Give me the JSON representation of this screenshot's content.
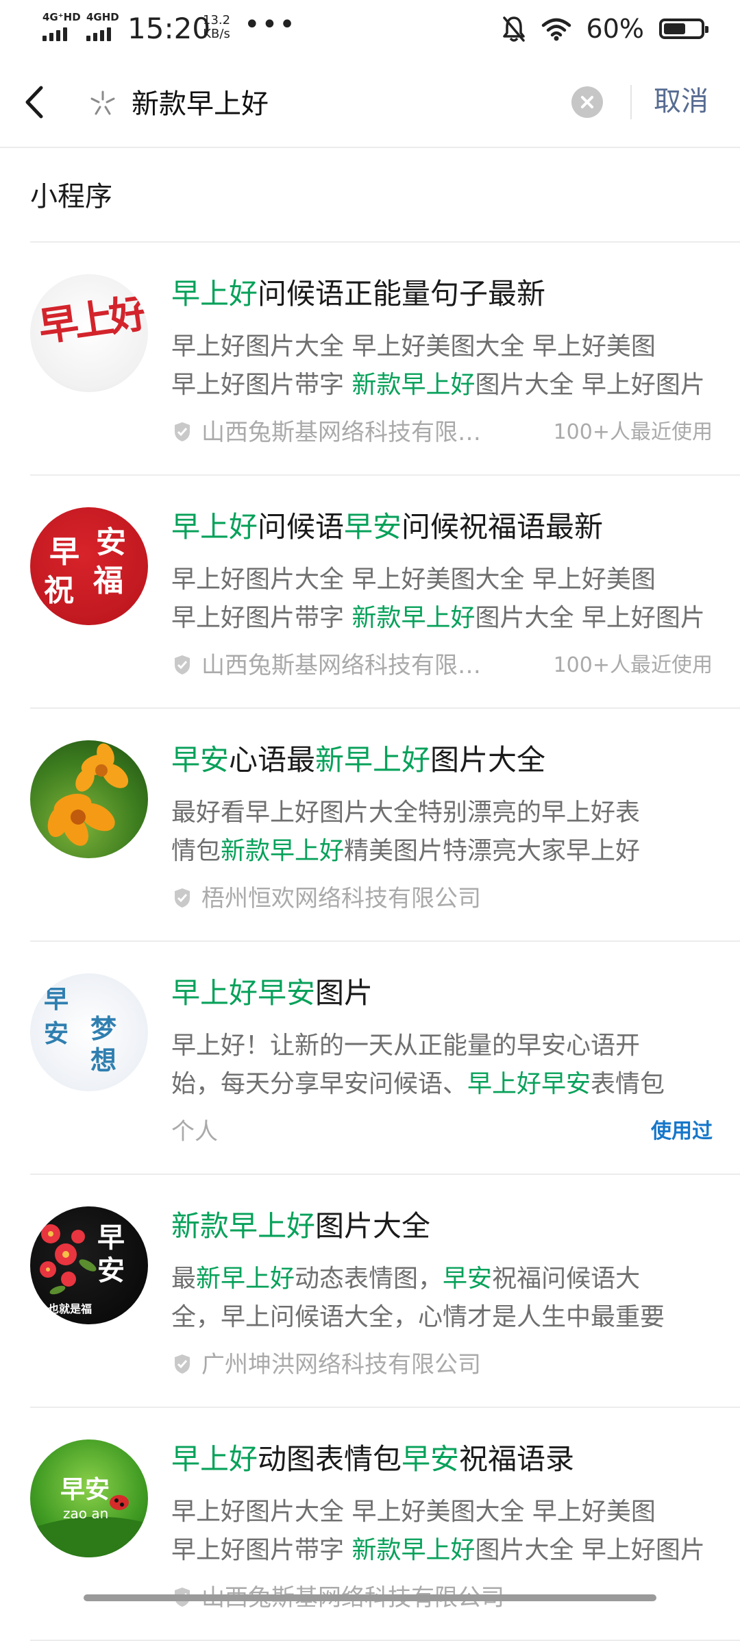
{
  "status_bar": {
    "net1": "4G⁺HD",
    "net2": "4GHD",
    "time": "15:20",
    "speed_value": "13.2",
    "speed_unit": "KB/s",
    "more": "•••",
    "battery_pct": "60%",
    "battery_level": 0.6
  },
  "search": {
    "query": "新款早上好",
    "cancel_label": "取消"
  },
  "section_title": "小程序",
  "colors": {
    "highlight": "#07a15a",
    "link_blue": "#1677c9",
    "cancel": "#566b91"
  },
  "results": [
    {
      "title": [
        {
          "t": "早上好",
          "h": true
        },
        {
          "t": "问候语正能量句子最新",
          "h": false
        }
      ],
      "desc1": [
        {
          "t": "早上好图片大全 早上好美图大全 早上好美图",
          "h": false
        }
      ],
      "desc2": [
        {
          "t": "早上好图片带字 ",
          "h": false
        },
        {
          "t": "新款早上好",
          "h": true
        },
        {
          "t": "图片大全 早上好图片",
          "h": false
        }
      ],
      "company": "山西兔斯基网络科技有限…",
      "verified": true,
      "usage": "100+人最近使用",
      "avatar_chars": [
        "早上好"
      ]
    },
    {
      "title": [
        {
          "t": "早上好",
          "h": true
        },
        {
          "t": "问候语",
          "h": false
        },
        {
          "t": "早安",
          "h": true
        },
        {
          "t": "问候祝福语最新",
          "h": false
        }
      ],
      "desc1": [
        {
          "t": "早上好图片大全 早上好美图大全 早上好美图",
          "h": false
        }
      ],
      "desc2": [
        {
          "t": "早上好图片带字 ",
          "h": false
        },
        {
          "t": "新款早上好",
          "h": true
        },
        {
          "t": "图片大全 早上好图片",
          "h": false
        }
      ],
      "company": "山西兔斯基网络科技有限…",
      "verified": true,
      "usage": "100+人最近使用",
      "avatar_chars": [
        "早",
        "安",
        "祝",
        "福"
      ]
    },
    {
      "title": [
        {
          "t": "早安",
          "h": true
        },
        {
          "t": "心语最",
          "h": false
        },
        {
          "t": "新早上好",
          "h": true
        },
        {
          "t": "图片大全",
          "h": false
        }
      ],
      "desc1": [
        {
          "t": "最好看早上好图片大全特别漂亮的早上好表",
          "h": false
        }
      ],
      "desc2": [
        {
          "t": "情包",
          "h": false
        },
        {
          "t": "新款早上好",
          "h": true
        },
        {
          "t": "精美图片特漂亮大家早上好",
          "h": false
        }
      ],
      "company": "梧州恒欢网络科技有限公司",
      "verified": true,
      "usage": ""
    },
    {
      "title": [
        {
          "t": "早上好早安",
          "h": true
        },
        {
          "t": "图片",
          "h": false
        }
      ],
      "desc1": [
        {
          "t": "早上好！让新的一天从正能量的早安心语开",
          "h": false
        }
      ],
      "desc2": [
        {
          "t": "始，每天分享早安问候语、",
          "h": false
        },
        {
          "t": "早上好早安",
          "h": true
        },
        {
          "t": "表情包",
          "h": false
        }
      ],
      "company": "个人",
      "verified": false,
      "usage": "使用过",
      "avatar_chars": [
        "早",
        "安",
        "梦",
        "想"
      ]
    },
    {
      "title": [
        {
          "t": "新款早上好",
          "h": true
        },
        {
          "t": "图片大全",
          "h": false
        }
      ],
      "desc1": [
        {
          "t": "最",
          "h": false
        },
        {
          "t": "新早上好",
          "h": true
        },
        {
          "t": "动态表情图，",
          "h": false
        },
        {
          "t": "早安",
          "h": true
        },
        {
          "t": "祝福问候语大",
          "h": false
        }
      ],
      "desc2": [
        {
          "t": "全，早上问候语大全，心情才是人生中最重要",
          "h": false
        }
      ],
      "company": "广州坤洪网络科技有限公司",
      "verified": true,
      "usage": "",
      "avatar_chars": [
        "早",
        "安",
        "也就是福"
      ]
    },
    {
      "title": [
        {
          "t": "早上好",
          "h": true
        },
        {
          "t": "动图表情包",
          "h": false
        },
        {
          "t": "早安",
          "h": true
        },
        {
          "t": "祝福语录",
          "h": false
        }
      ],
      "desc1": [
        {
          "t": "早上好图片大全 早上好美图大全 早上好美图",
          "h": false
        }
      ],
      "desc2": [
        {
          "t": "早上好图片带字 ",
          "h": false
        },
        {
          "t": "新款早上好",
          "h": true
        },
        {
          "t": "图片大全 早上好图片",
          "h": false
        }
      ],
      "company": "山西兔斯基网络科技有限公司",
      "verified": true,
      "usage": "",
      "avatar_chars": [
        "早安",
        "zao an"
      ]
    }
  ]
}
